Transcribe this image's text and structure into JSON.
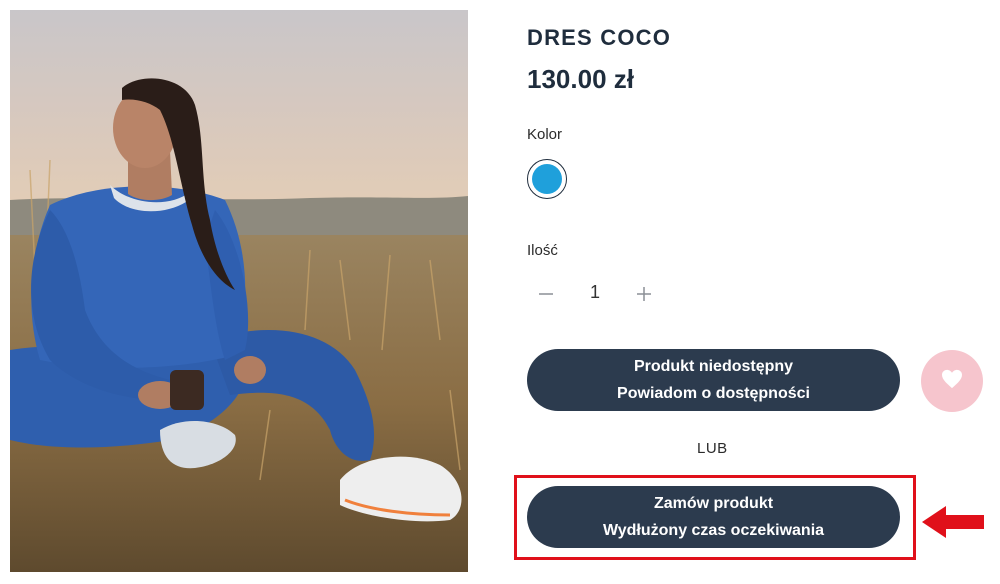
{
  "product": {
    "title": "DRES COCO",
    "price": "130.00 zł"
  },
  "color": {
    "label": "Kolor",
    "swatch_color": "#1fa0db"
  },
  "quantity": {
    "label": "Ilość",
    "value": "1",
    "minus_icon": "minus-icon",
    "plus_icon": "plus-icon"
  },
  "notify_button": {
    "line1": "Produkt niedostępny",
    "line2": "Powiadom o dostępności"
  },
  "wishlist": {
    "icon": "heart-icon",
    "bg_color": "#f6c5cd"
  },
  "separator": "LUB",
  "order_button": {
    "line1": "Zamów produkt",
    "line2": "Wydłużony czas oczekiwania"
  },
  "annotation": {
    "highlight_color": "#e0101a",
    "arrow_icon": "arrow-left-icon"
  },
  "colors": {
    "button_bg": "#2c3b4e",
    "text_dark": "#1f2d3d"
  }
}
